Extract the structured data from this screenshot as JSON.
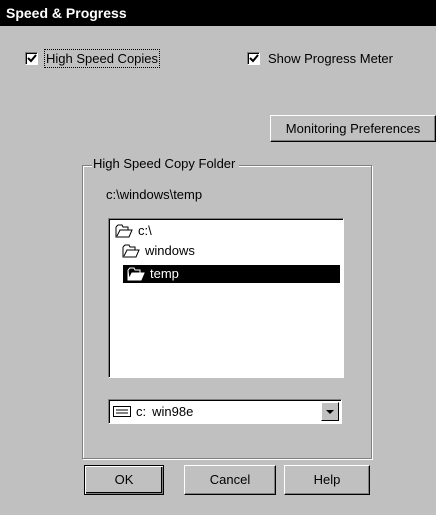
{
  "window": {
    "title": "Speed & Progress"
  },
  "options": {
    "high_speed": {
      "label": "High Speed Copies",
      "checked": true
    },
    "show_progress": {
      "label": "Show Progress Meter",
      "checked": true
    }
  },
  "monitoring_button": "Monitoring Preferences",
  "folder_group": {
    "title": "High Speed Copy Folder",
    "path": "c:\\windows\\temp",
    "tree": [
      {
        "label": "c:\\",
        "icon": "open-folder-icon",
        "selected": false
      },
      {
        "label": "windows",
        "icon": "open-folder-icon",
        "selected": false
      },
      {
        "label": "temp",
        "icon": "open-folder-icon",
        "selected": true
      }
    ],
    "drive": {
      "letter": "c:",
      "name": "win98e",
      "icon": "hard-drive-icon"
    }
  },
  "buttons": {
    "ok": "OK",
    "cancel": "Cancel",
    "help": "Help"
  }
}
